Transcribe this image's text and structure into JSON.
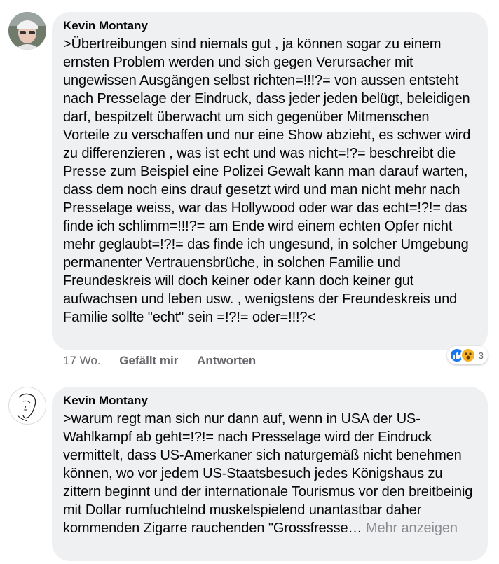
{
  "comments": [
    {
      "author": "Kevin Montany",
      "text": ">Übertreibungen sind niemals gut , ja können sogar zu einem ernsten Problem werden und sich gegen Verursacher mit ungewissen Ausgängen selbst richten=!!!?= von aussen entsteht nach Presselage der Eindruck, dass jeder jeden belügt, beleidigen darf, bespitzelt überwacht um sich gegenüber Mitmenschen Vorteile zu verschaffen  und nur eine Show abzieht, es schwer wird zu differenzieren , was ist echt und was nicht=!?= beschreibt die Presse zum Beispiel eine Polizei Gewalt kann man darauf warten, dass dem noch eins drauf gesetzt wird und man nicht mehr nach Presselage weiss, war das Hollywood oder war das echt=!?!= das finde ich schlimm=!!!?= am Ende wird einem echten Opfer nicht mehr geglaubt=!?!= das finde ich ungesund, in solcher Umgebung permanenter Vertrauensbrüche, in solchen  Familie  und Freundeskreis will doch keiner oder kann doch keiner gut aufwachsen und leben usw. , wenigstens der Freundeskreis und Familie sollte \"echt\" sein =!?!= oder=!!!?<",
      "time": "17 Wo.",
      "like_label": "Gefällt mir",
      "reply_label": "Antworten",
      "reaction_count": "3",
      "reaction_icons": [
        "like-icon",
        "wow-icon"
      ]
    },
    {
      "author": "Kevin Montany",
      "text": ">warum regt man sich nur dann auf, wenn  in USA der US-Wahlkampf ab geht=!?!= nach Presselage wird der Eindruck vermittelt, dass  US-Amerkaner sich naturgemäß nicht benehmen können, wo vor jedem US-Staatsbesuch jedes Königshaus zu zittern beginnt und der internationale Tourismus vor den breitbeinig mit Dollar rumfuchtelnd muskelspielend unantastbar daher kommenden Zigarre rauchenden \"Grossfresse…",
      "more_label": "Mehr anzeigen"
    }
  ]
}
